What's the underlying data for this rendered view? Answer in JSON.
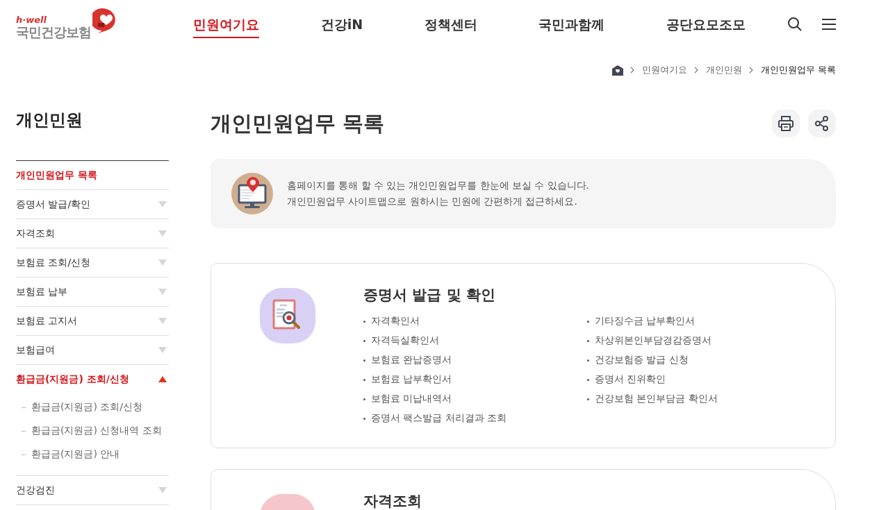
{
  "logo": {
    "tagline": "h·well",
    "name": "국민건강보험"
  },
  "nav": [
    {
      "label": "민원여기요",
      "selected": true
    },
    {
      "label": "건강iN",
      "selected": false
    },
    {
      "label": "정책센터",
      "selected": false
    },
    {
      "label": "국민과함께",
      "selected": false
    },
    {
      "label": "공단요모조모",
      "selected": false
    }
  ],
  "breadcrumb": [
    "민원여기요",
    "개인민원",
    "개인민원업무 목록"
  ],
  "sidebar": {
    "title": "개인민원",
    "items": [
      {
        "kind": "link",
        "label": "개인민원업무 목록",
        "selected": true
      },
      {
        "kind": "group",
        "label": "증명서 발급/확인",
        "selected": false,
        "expanded": false
      },
      {
        "kind": "group",
        "label": "자격조회",
        "selected": false,
        "expanded": false
      },
      {
        "kind": "group",
        "label": "보험료 조회/신청",
        "selected": false,
        "expanded": false
      },
      {
        "kind": "group",
        "label": "보험료 납부",
        "selected": false,
        "expanded": false
      },
      {
        "kind": "group",
        "label": "보험료 고지서",
        "selected": false,
        "expanded": false
      },
      {
        "kind": "group",
        "label": "보험급여",
        "selected": false,
        "expanded": false
      },
      {
        "kind": "group",
        "label": "환급금(지원금) 조회/신청",
        "selected": true,
        "expanded": true,
        "children": [
          {
            "label": "환급금(지원금) 조회/신청"
          },
          {
            "label": "환급금(지원금) 신청내역 조회"
          },
          {
            "label": "환급금(지원금) 안내"
          }
        ]
      },
      {
        "kind": "group",
        "label": "건강검진",
        "selected": false,
        "expanded": false
      }
    ]
  },
  "page_title": "개인민원업무 목록",
  "intro": [
    "홈페이지를 통해 할 수 있는 개인민원업무를 한눈에 보실 수 있습니다.",
    "개인민원업무 사이트맵으로 원하시는 민원에 간편하게 접근하세요."
  ],
  "sections": [
    {
      "title": "증명서 발급 및 확인",
      "kind": "document",
      "color": "#d9d0f5",
      "items": [
        "자격확인서",
        "자격득실확인서",
        "보험료 완납증명서",
        "보험료 납부확인서",
        "보험료 미납내역서",
        "증명서 팩스발급 처리결과 조회",
        "기타징수금 납부확인서",
        "차상위본인부담경감증명서",
        "건강보험증 발급 신청",
        "증명서 진위확인",
        "건강보험 본인부담금 확인서"
      ]
    },
    {
      "title": "자격조회",
      "kind": "blank",
      "color": "#f6c6cb"
    }
  ]
}
